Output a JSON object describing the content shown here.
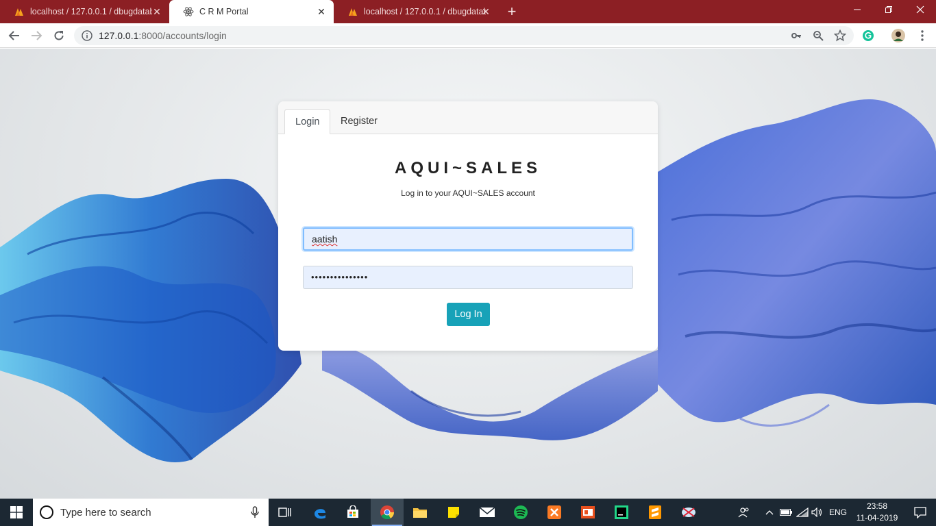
{
  "browser": {
    "tabs": [
      {
        "title": "localhost / 127.0.0.1 / dbugdatab",
        "active": false
      },
      {
        "title": "C R M Portal",
        "active": true
      },
      {
        "title": "localhost / 127.0.0.1 / dbugdatab",
        "active": false
      }
    ],
    "url_host": "127.0.0.1",
    "url_path": ":8000/accounts/login"
  },
  "login_card": {
    "tabs": [
      "Login",
      "Register"
    ],
    "brand": "AQUI~SALES",
    "tagline": "Log in to your AQUI~SALES account",
    "username_value": "aatish",
    "password_mask": "•••••••••••••••",
    "submit_label": "Log In"
  },
  "taskbar": {
    "search_placeholder": "Type here to search",
    "language": "ENG",
    "time": "23:58",
    "date": "11-04-2019"
  },
  "colors": {
    "titlebar": "#8c1f24",
    "button": "#17a2b8",
    "taskbar": "#1c2833"
  }
}
